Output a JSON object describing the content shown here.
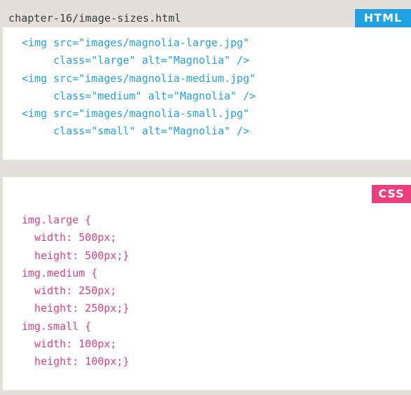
{
  "html_panel": {
    "filename": "chapter-16/image-sizes.html",
    "badge": "HTML",
    "lines": [
      "<img src=\"images/magnolia-large.jpg\"",
      "     class=\"large\" alt=\"Magnolia\" />",
      "<img src=\"images/magnolia-medium.jpg\"",
      "     class=\"medium\" alt=\"Magnolia\" />",
      "<img src=\"images/magnolia-small.jpg\"",
      "     class=\"small\" alt=\"Magnolia\" />"
    ]
  },
  "css_panel": {
    "badge": "CSS",
    "lines": [
      "img.large {",
      "  width: 500px;",
      "  height: 500px;}",
      "img.medium {",
      "  width: 250px;",
      "  height: 250px;}",
      "img.small {",
      "  width: 100px;",
      "  height: 100px;}"
    ]
  },
  "colors": {
    "background": "#e3e0db",
    "html_accent": "#1ea2e4",
    "css_accent": "#ea3e7e",
    "filename_text": "#3a3a3a"
  }
}
